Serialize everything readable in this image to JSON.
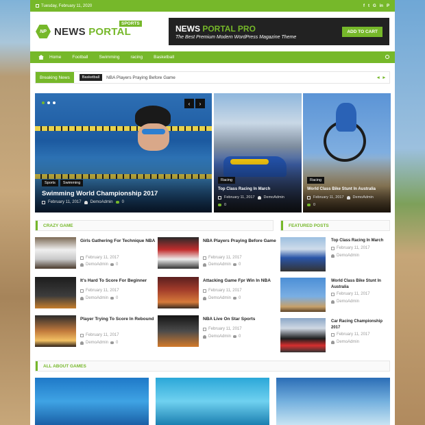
{
  "topbar": {
    "date": "Tuesday, February 11, 2020",
    "social": [
      "f",
      "t",
      "G",
      "in",
      "P"
    ]
  },
  "header": {
    "logo_mark": "NP",
    "logo_text_1": "NEWS",
    "logo_text_2": "PORTAL",
    "logo_badge": "SPORTS",
    "banner_title_1": "NEWS",
    "banner_title_2": "PORTAL PRO",
    "banner_subtitle": "The Best Premium Modern WordPress Magazine Theme",
    "banner_cta": "ADD TO CART"
  },
  "nav": {
    "items": [
      "Home",
      "Football",
      "Swimming",
      "racing",
      "Basketball"
    ]
  },
  "breaking": {
    "label": "Breaking News",
    "tag": "Basketball",
    "text": "NBA Players Praying Before Game",
    "prev": "◂",
    "next": "▸"
  },
  "slider": {
    "prev": "‹",
    "next": "›",
    "main": {
      "tags": [
        "Sports",
        "Swimming"
      ],
      "title": "Swimming World Championship 2017",
      "date": "February 11, 2017",
      "author": "DemoAdmin",
      "comments": "0"
    },
    "side": [
      {
        "tag": "Racing",
        "title": "Top Class Racing In March",
        "date": "February 11, 2017",
        "author": "DemoAdmin",
        "comments": "0"
      },
      {
        "tag": "Racing",
        "title": "World Class Bike Stunt In Australia",
        "date": "February 11, 2017",
        "author": "DemoAdmin",
        "comments": "0"
      }
    ]
  },
  "crazy_game": {
    "title": "CRAZY GAME",
    "posts": [
      {
        "title": "Girls Gathering For Technique NBA",
        "date": "February 11, 2017",
        "author": "DemoAdmin",
        "comments": "0"
      },
      {
        "title": "NBA Players Praying Before Game",
        "date": "February 11, 2017",
        "author": "DemoAdmin",
        "comments": "0"
      },
      {
        "title": "It's Hard To Score For Beginner",
        "date": "February 11, 2017",
        "author": "DemoAdmin",
        "comments": "0"
      },
      {
        "title": "Attacking Game Fpr Win In NBA",
        "date": "February 11, 2017",
        "author": "DemoAdmin",
        "comments": "0"
      },
      {
        "title": "Player Trying To Score In Rebound",
        "date": "February 11, 2017",
        "author": "DemoAdmin",
        "comments": "0"
      },
      {
        "title": "NBA Live On Star Sports",
        "date": "February 11, 2017",
        "author": "DemoAdmin",
        "comments": "0"
      }
    ]
  },
  "featured": {
    "title": "FEATURED POSTS",
    "posts": [
      {
        "title": "Top Class Racing In March",
        "date": "February 11, 2017",
        "author": "DemoAdmin"
      },
      {
        "title": "World Class Bike Stunt In Australia",
        "date": "February 11, 2017",
        "author": "DemoAdmin"
      },
      {
        "title": "Car Racing Championship 2017",
        "date": "February 11, 2017",
        "author": "DemoAdmin"
      }
    ]
  },
  "all_about": {
    "title": "ALL ABOUT GAMES"
  },
  "colors": {
    "accent": "#76b82a",
    "dark": "#222222"
  }
}
